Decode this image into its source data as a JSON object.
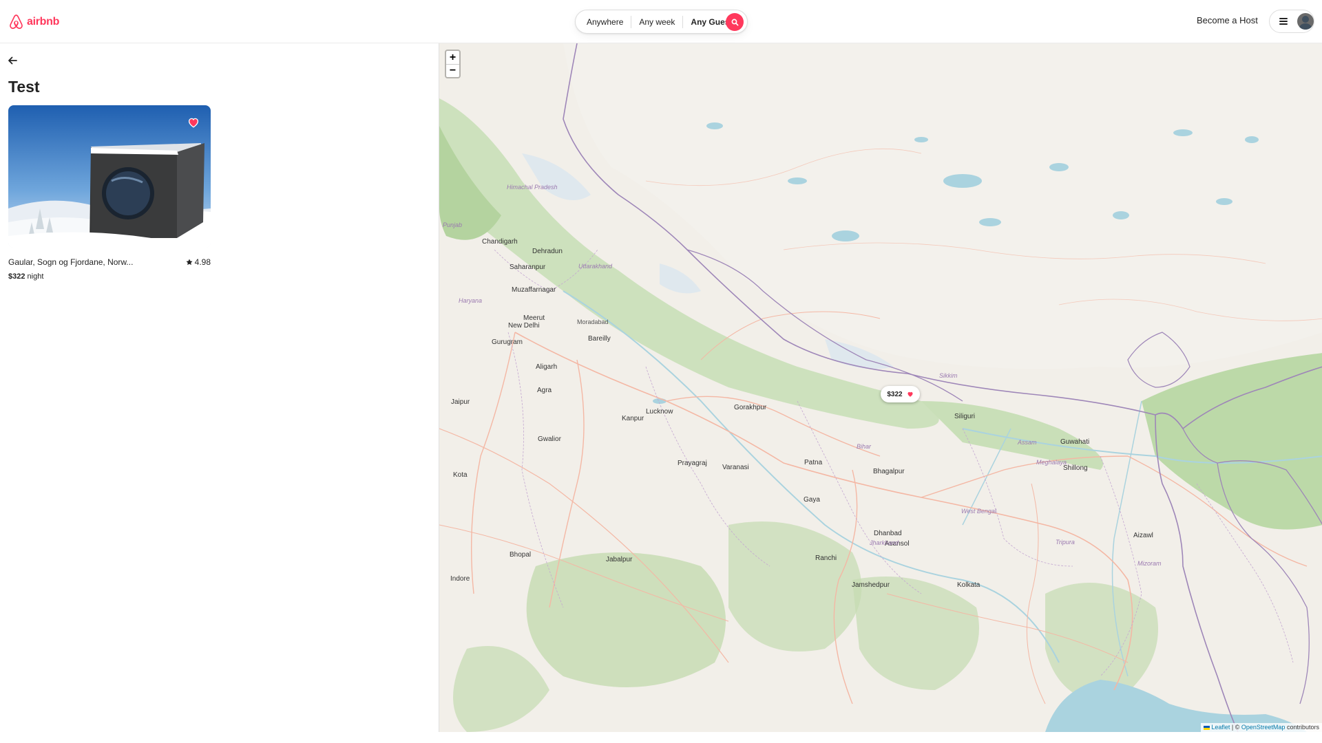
{
  "header": {
    "logo_text": "airbnb",
    "search": {
      "anywhere": "Anywhere",
      "any_week": "Any week",
      "any_guest": "Any Guest"
    },
    "become_host": "Become a Host"
  },
  "wishlist": {
    "title": "Test",
    "listings": [
      {
        "location": "Gaular, Sogn og Fjordane, Norw...",
        "rating": "4.98",
        "price": "$322",
        "price_unit": "night",
        "favorited": true
      }
    ]
  },
  "map": {
    "zoom_in": "+",
    "zoom_out": "−",
    "marker_price": "$322",
    "attribution": {
      "leaflet": "Leaflet",
      "separator": "| ©",
      "osm": "OpenStreetMap",
      "suffix": "contributors"
    },
    "cities": [
      "New Delhi",
      "Lucknow",
      "Kanpur",
      "Patna",
      "Gwalior",
      "Kota",
      "Bhopal",
      "Jabalpur",
      "Ranchi",
      "Gaya",
      "Varanasi",
      "Gorakhpur",
      "Prayagraj",
      "Dhanbad",
      "Asansol",
      "Bhagalpur",
      "Siliguri",
      "Guwahati",
      "Kolkata",
      "Jamshedpur",
      "Dehradun",
      "Chandigarh",
      "Meerut",
      "Bareilly",
      "Aligarh",
      "Agra",
      "Jaipur",
      "Indore",
      "Shillong",
      "Aizawl",
      "Gurugram",
      "Moradabad",
      "Saharanpur",
      "Muzaffarnagar"
    ],
    "regions": [
      "Himachal Pradesh",
      "Uttarakhand",
      "Punjab",
      "Haryana",
      "Bihar",
      "Jharkhand",
      "West Bengal",
      "Meghalaya",
      "Assam",
      "Tripura",
      "Mizoram",
      "Sikkim"
    ],
    "colors": {
      "land": "#f2efe9",
      "forest": "#add19e",
      "water": "#aad3df",
      "border": "#8b7bb0",
      "road": "#f4b7a4",
      "brand": "#ff385c"
    }
  }
}
